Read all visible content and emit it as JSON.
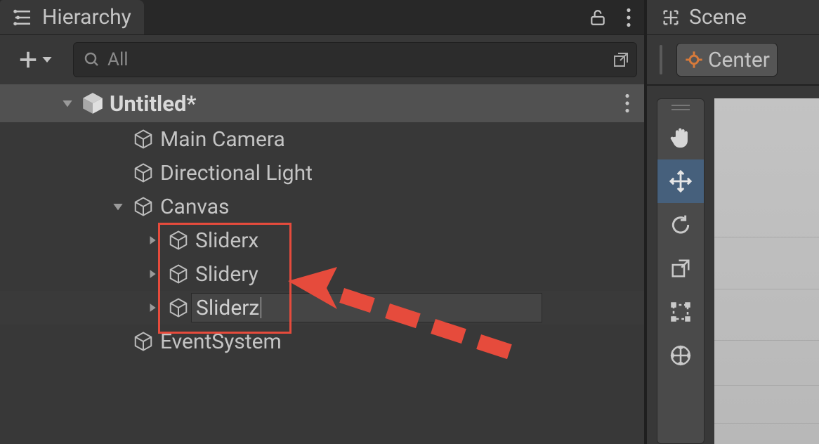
{
  "hierarchy": {
    "tab_label": "Hierarchy",
    "search_value": "All",
    "scene_name": "Untitled*",
    "items": {
      "main_camera": "Main Camera",
      "directional_light": "Directional Light",
      "canvas": "Canvas",
      "sliderx": "Sliderx",
      "slidery": "Slidery",
      "sliderz": "Sliderz",
      "event_system": "EventSystem"
    }
  },
  "scene": {
    "tab_label": "Scene",
    "pivot_mode": "Center"
  }
}
